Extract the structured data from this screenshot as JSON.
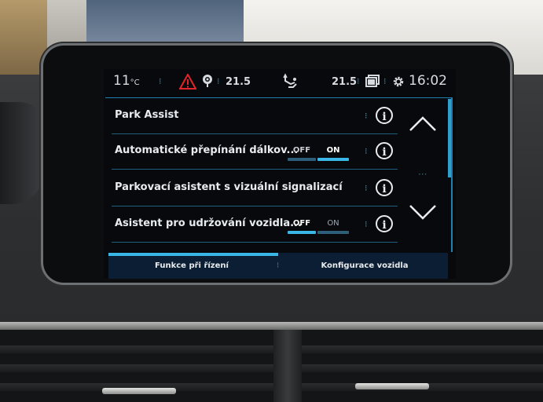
{
  "status_bar": {
    "outside_temp": "11",
    "outside_temp_unit": "°C",
    "left_temp": "21.5",
    "right_temp": "21.5",
    "time": "16:02",
    "icons": [
      "warning-icon",
      "gps-icon",
      "fan-airflow-icon",
      "mirror-icon",
      "gear-icon"
    ]
  },
  "settings_list": {
    "rows": [
      {
        "label": "Park Assist",
        "has_toggle": false
      },
      {
        "label": "Automatické přepínání dálkov...",
        "has_toggle": true,
        "off_label": "OFF",
        "on_label": "ON",
        "state": "ON"
      },
      {
        "label": "Parkovací asistent s vizuální signalizací",
        "has_toggle": false
      },
      {
        "label": "Asistent pro udržování vozidla...",
        "has_toggle": true,
        "off_label": "OFF",
        "on_label": "ON",
        "state": "OFF"
      }
    ],
    "info_icon": "info-icon"
  },
  "tabs": {
    "items": [
      {
        "label": "Funkce při řízení",
        "active": true
      },
      {
        "label": "Konfigurace vozidla",
        "active": false
      }
    ]
  },
  "colors": {
    "accent": "#3ab7e6",
    "warning": "#e2262b",
    "text": "#e8ecef",
    "background": "#07090d"
  }
}
